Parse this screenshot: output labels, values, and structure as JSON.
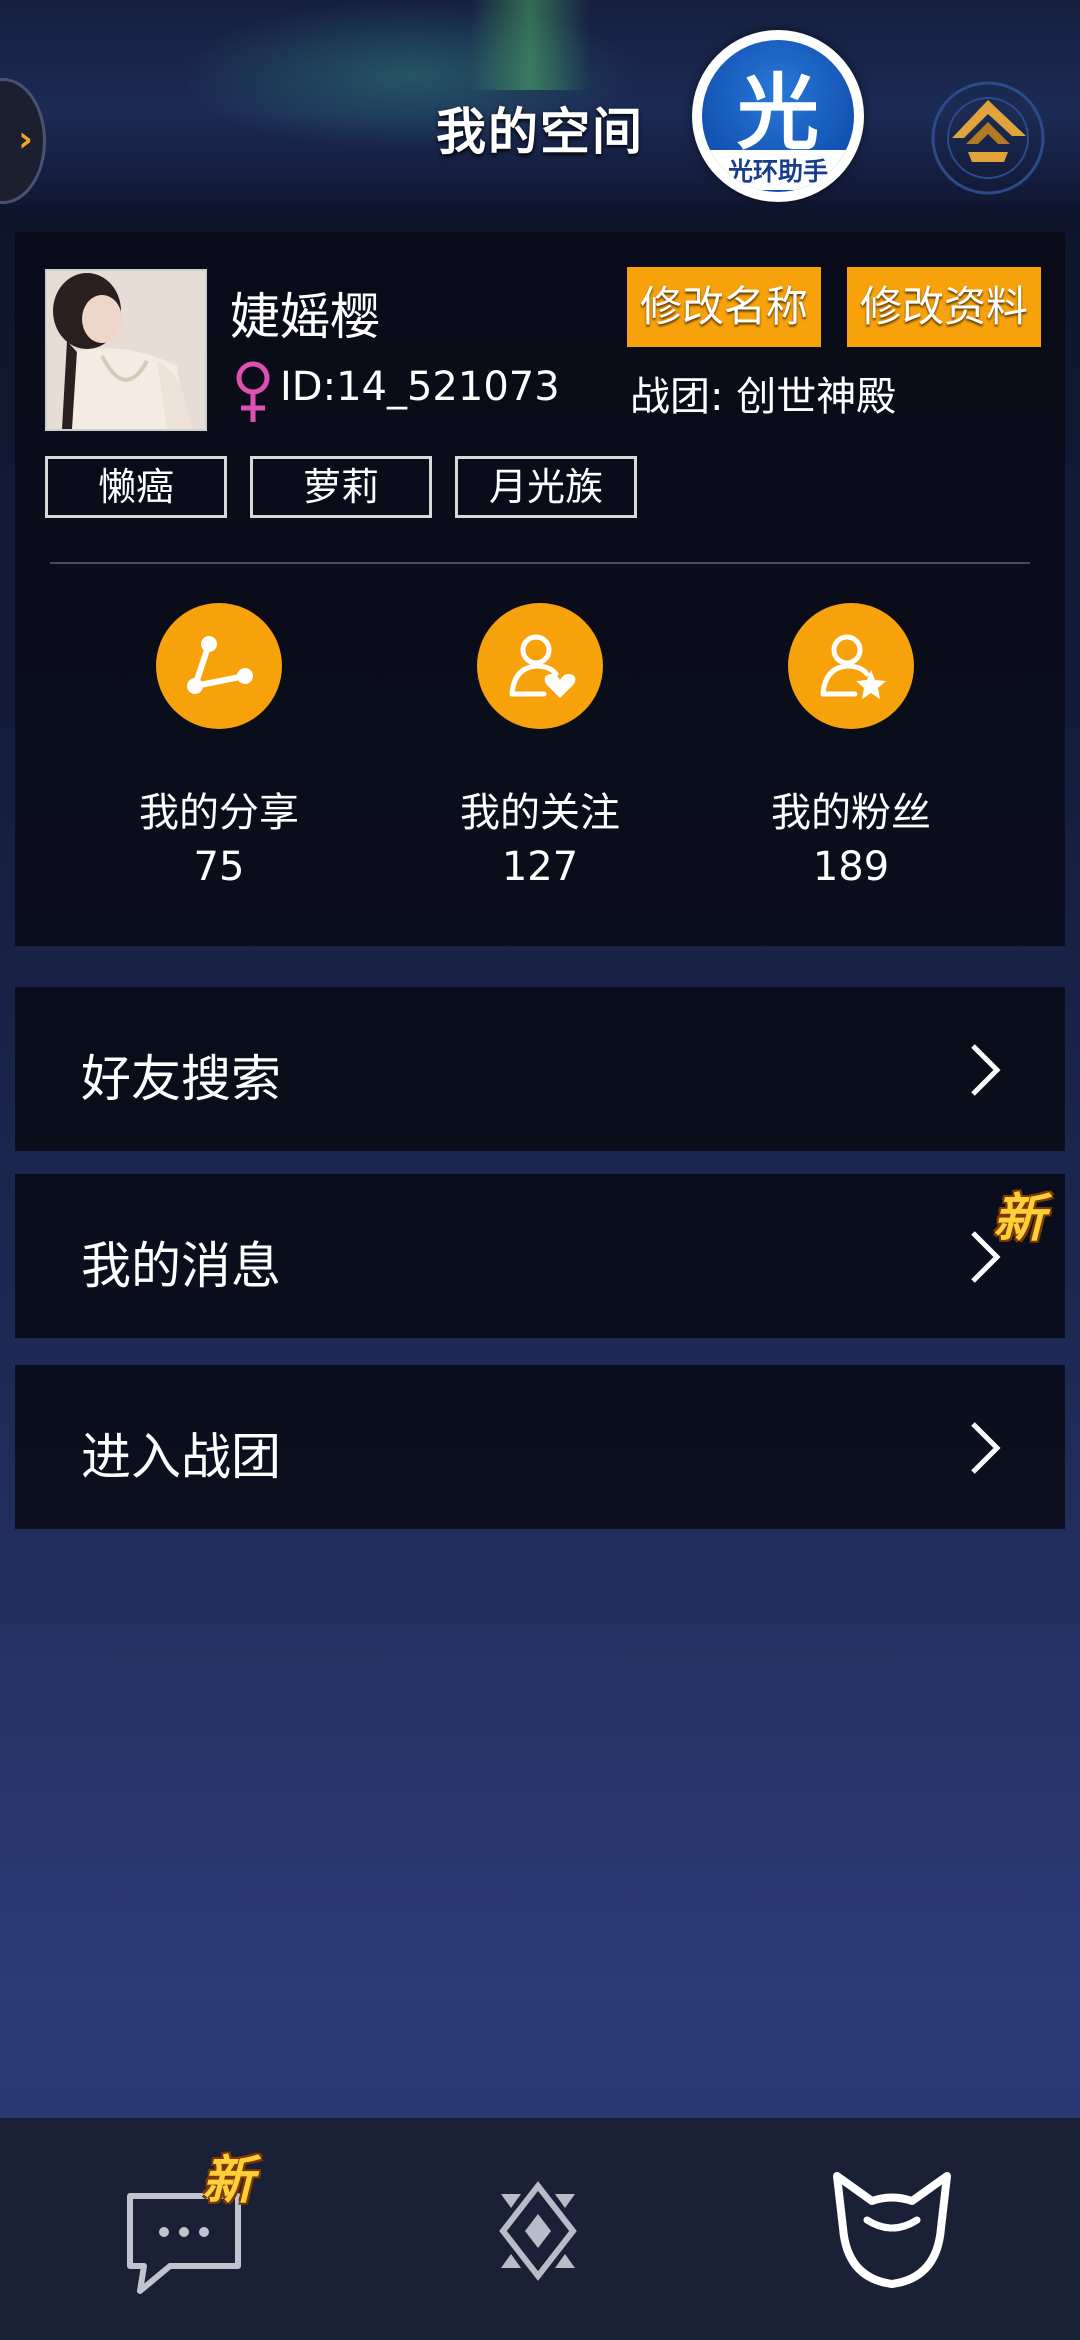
{
  "header": {
    "title": "我的空间",
    "assistant_big": "光",
    "assistant_small": "光环助手"
  },
  "profile": {
    "username": "婕媱樱",
    "user_id": "ID:14_521073",
    "team": "战团: 创世神殿",
    "rename_button": "修改名称",
    "edit_button": "修改资料",
    "tags": [
      "懒癌",
      "萝莉",
      "月光族"
    ]
  },
  "stats": [
    {
      "label": "我的分享",
      "value": "75"
    },
    {
      "label": "我的关注",
      "value": "127"
    },
    {
      "label": "我的粉丝",
      "value": "189"
    }
  ],
  "menu": [
    {
      "label": "好友搜索"
    },
    {
      "label": "我的消息",
      "badge": "新"
    },
    {
      "label": "进入战团"
    }
  ],
  "bottom_nav": {
    "chat_badge": "新",
    "items": [
      "chat-icon",
      "diamond-icon",
      "cat-face-icon"
    ]
  },
  "colors": {
    "accent": "#f7a10b",
    "gender": "#e04fb3",
    "badge": "#ffcf3a"
  }
}
